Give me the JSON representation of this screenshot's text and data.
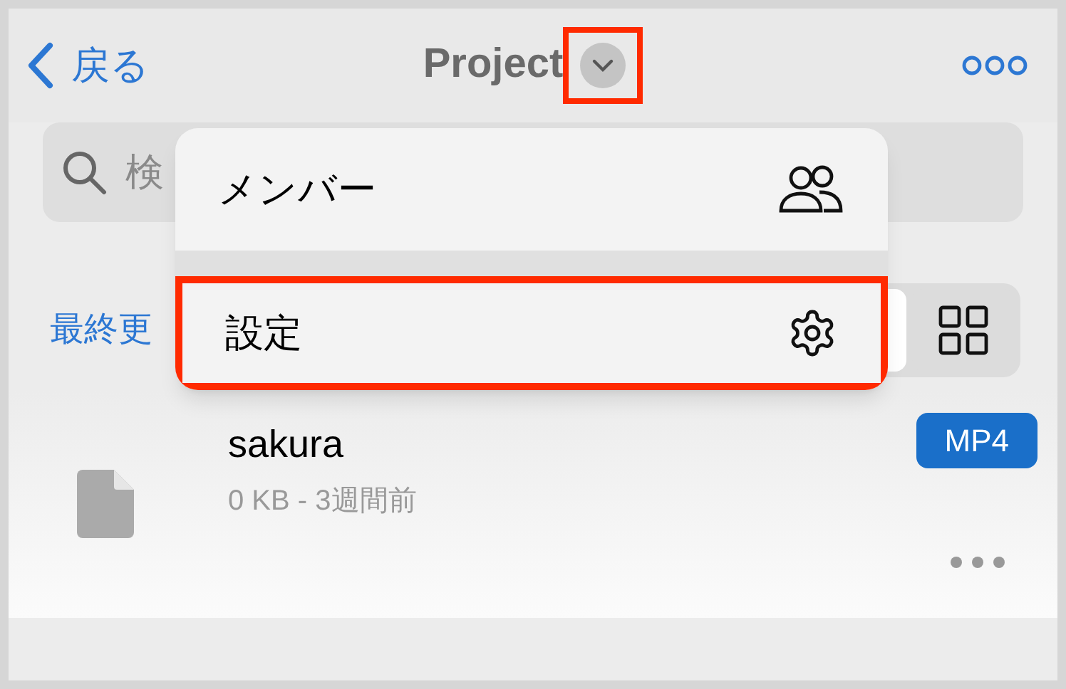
{
  "header": {
    "back_label": "戻る",
    "title": "Project",
    "title_menu_highlighted": true
  },
  "search": {
    "placeholder": "検"
  },
  "sort": {
    "label": "最終更"
  },
  "view_modes": [
    {
      "kind": "list",
      "selected": true
    },
    {
      "kind": "grid",
      "selected": false
    }
  ],
  "files": [
    {
      "name": "sakura",
      "meta": "0 KB - 3週間前",
      "badge": "MP4"
    }
  ],
  "menu": {
    "items": [
      {
        "kind": "members",
        "label": "メンバー",
        "highlighted": false
      },
      {
        "kind": "settings",
        "label": "設定",
        "highlighted": true
      }
    ]
  }
}
